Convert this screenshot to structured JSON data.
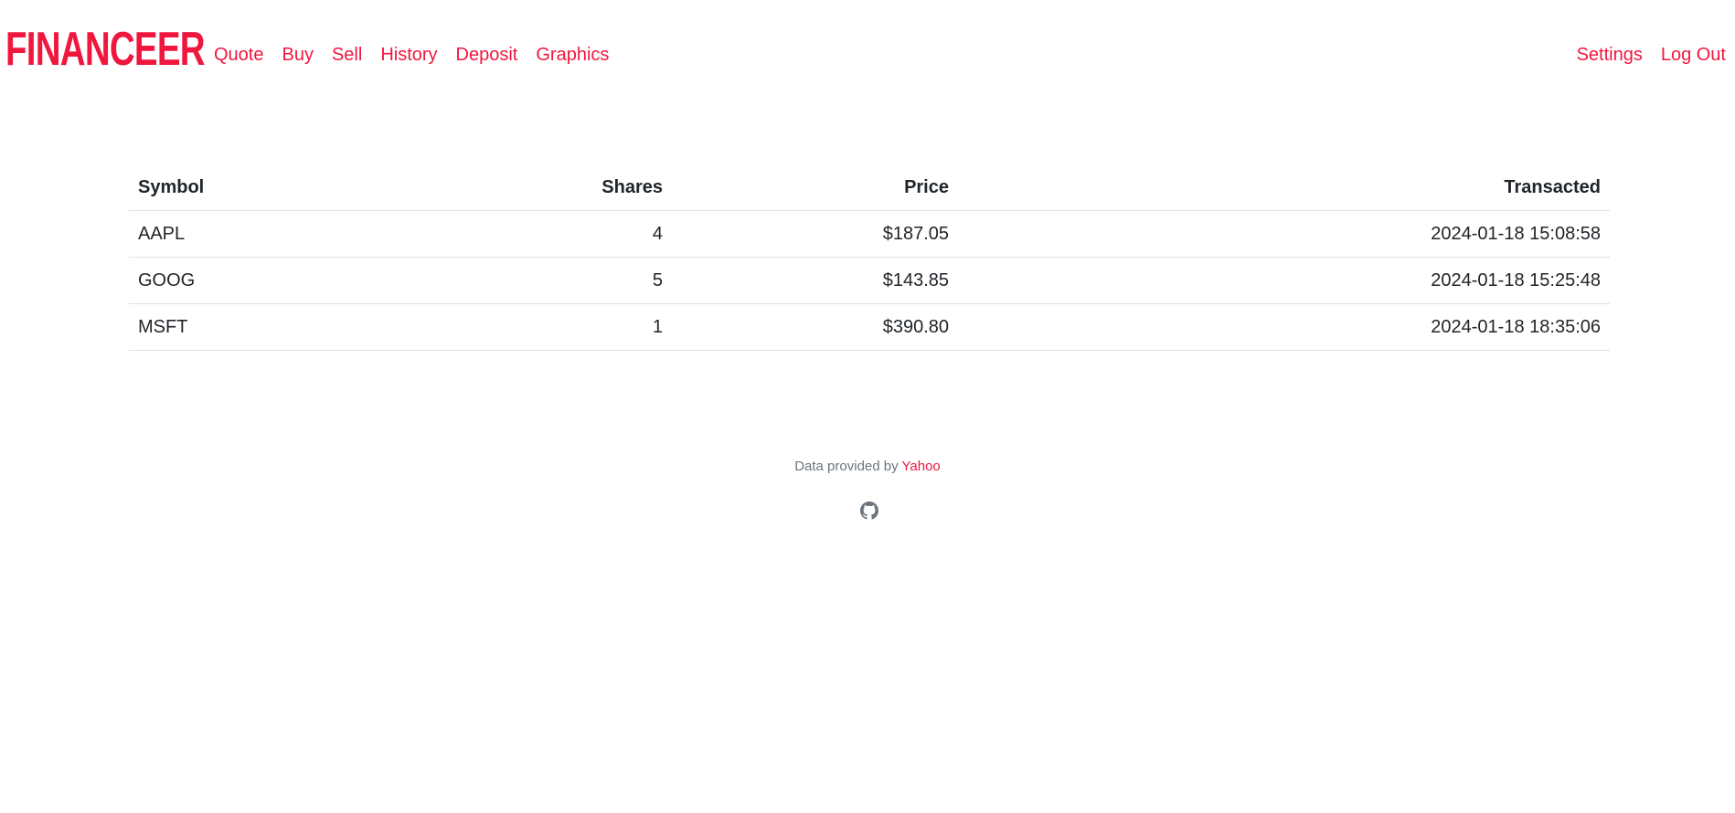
{
  "brand": "FINANCEER",
  "nav": {
    "left": [
      "Quote",
      "Buy",
      "Sell",
      "History",
      "Deposit",
      "Graphics"
    ],
    "right": [
      "Settings",
      "Log Out"
    ]
  },
  "table": {
    "headers": [
      "Symbol",
      "Shares",
      "Price",
      "Transacted"
    ],
    "rows": [
      [
        "AAPL",
        "4",
        "$187.05",
        "2024-01-18 15:08:58"
      ],
      [
        "GOOG",
        "5",
        "$143.85",
        "2024-01-18 15:25:48"
      ],
      [
        "MSFT",
        "1",
        "$390.80",
        "2024-01-18 18:35:06"
      ]
    ]
  },
  "footer": {
    "text": "Data provided by",
    "link": "Yahoo",
    "icon": "github-icon"
  },
  "colors": {
    "accent": "#f0173f",
    "text": "#212529",
    "muted": "#6c757d",
    "border": "#dee2e6"
  }
}
